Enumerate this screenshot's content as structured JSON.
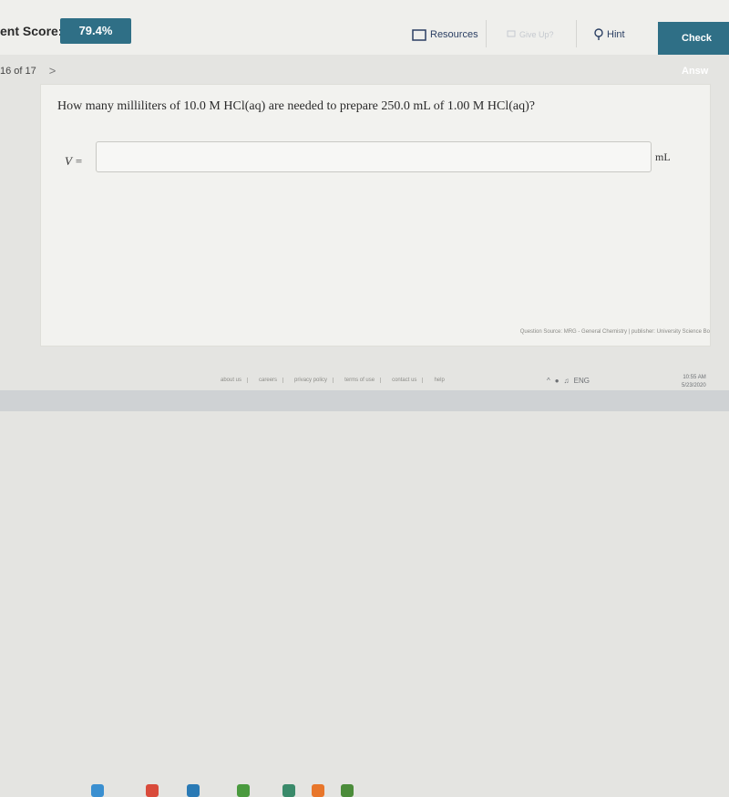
{
  "header": {
    "score_label": "ent Score:",
    "score_value": "79.4%",
    "resources_label": "Resources",
    "giveup_label": "Give Up?",
    "hint_label": "Hint",
    "check_label": "Check Answ"
  },
  "progress": {
    "label": "16 of 17",
    "next_glyph": ">"
  },
  "question": {
    "text": "How many milliliters of 10.0 M HCl(aq) are needed to prepare 250.0 mL of 1.00 M HCl(aq)?",
    "answer_label": "V =",
    "answer_value": "",
    "unit": "mL",
    "source": "Question Source: MRG - General Chemistry | publisher: University Science Bo"
  },
  "footer": {
    "links": [
      "about us",
      "careers",
      "privacy policy",
      "terms of use",
      "contact us",
      "help"
    ]
  },
  "taskbar": {
    "lang": "ENG",
    "time": "10:55 AM",
    "date": "5/23/2020"
  },
  "colors": {
    "accent": "#2f6f86",
    "topbar": "#efefec",
    "page": "#e4e4e1"
  }
}
